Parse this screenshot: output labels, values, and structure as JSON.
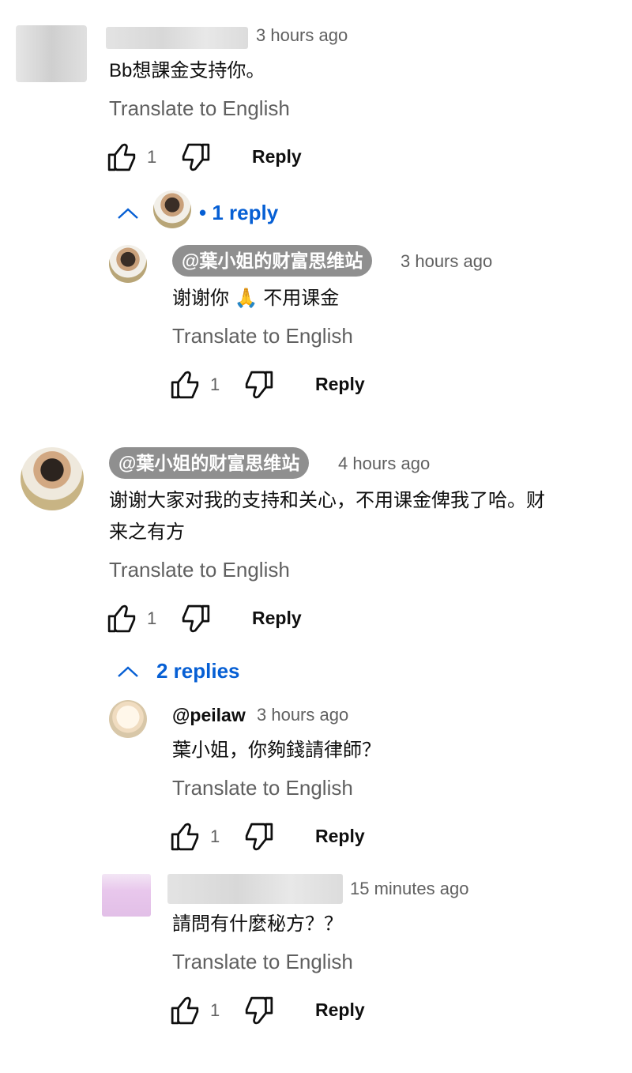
{
  "comments": [
    {
      "time": "3 hours ago",
      "text": "Bb想課金支持你。",
      "translate": "Translate to English",
      "likes": "1",
      "reply": "Reply",
      "replies_toggle": "1 reply",
      "replies": [
        {
          "author": "@葉小姐的财富思维站",
          "time": "3 hours ago",
          "text_before_emoji": "谢谢你",
          "emoji": "🙏",
          "text_after_emoji": "不用课金",
          "translate": "Translate to English",
          "likes": "1",
          "reply": "Reply"
        }
      ]
    },
    {
      "author": "@葉小姐的财富思维站",
      "time": "4 hours ago",
      "text_line1": "谢谢大家对我的支持和关心，不用课金俾我了哈。财",
      "text_line2": "来之有方",
      "translate": "Translate to English",
      "likes": "1",
      "reply": "Reply",
      "replies_toggle": "2 replies",
      "replies": [
        {
          "author": "@peilaw",
          "time": "3 hours ago",
          "text": "葉小姐，你夠錢請律師？",
          "translate": "Translate to English",
          "likes": "1",
          "reply": "Reply"
        },
        {
          "time": "15 minutes ago",
          "text": "請問有什麼秘方？？",
          "translate": "Translate to English",
          "likes": "1",
          "reply": "Reply"
        }
      ]
    }
  ],
  "icons": {
    "like": "thumb-up-icon",
    "dislike": "thumb-down-icon",
    "collapse": "chevron-up-icon"
  },
  "colors": {
    "link_blue": "#065fd4",
    "secondary_text": "#606060",
    "author_pill": "#8f8f8f"
  }
}
